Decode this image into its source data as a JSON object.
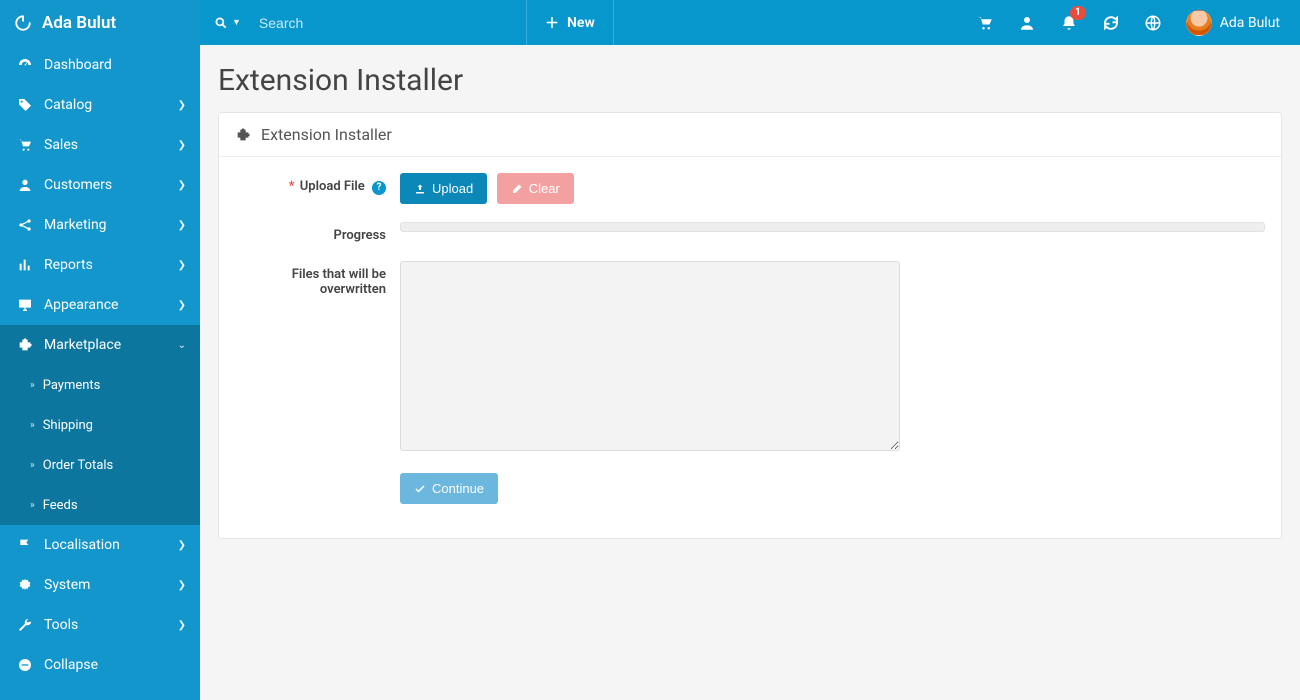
{
  "brand": {
    "name": "Ada Bulut"
  },
  "sidebar": {
    "items": [
      {
        "label": "Dashboard",
        "icon": "gauge",
        "expandable": false
      },
      {
        "label": "Catalog",
        "icon": "tag",
        "expandable": true
      },
      {
        "label": "Sales",
        "icon": "cart",
        "expandable": true
      },
      {
        "label": "Customers",
        "icon": "user",
        "expandable": true
      },
      {
        "label": "Marketing",
        "icon": "share",
        "expandable": true
      },
      {
        "label": "Reports",
        "icon": "bars",
        "expandable": true
      },
      {
        "label": "Appearance",
        "icon": "monitor",
        "expandable": true
      },
      {
        "label": "Marketplace",
        "icon": "puzzle",
        "expandable": true,
        "active": true,
        "children": [
          {
            "label": "Payments"
          },
          {
            "label": "Shipping"
          },
          {
            "label": "Order Totals"
          },
          {
            "label": "Feeds"
          }
        ]
      },
      {
        "label": "Localisation",
        "icon": "flag",
        "expandable": true
      },
      {
        "label": "System",
        "icon": "gear",
        "expandable": true
      },
      {
        "label": "Tools",
        "icon": "wrench",
        "expandable": true
      },
      {
        "label": "Collapse",
        "icon": "minus-circle",
        "expandable": false
      }
    ]
  },
  "topbar": {
    "search_placeholder": "Search",
    "new_label": "New",
    "notifications_count": "1",
    "user_name": "Ada Bulut"
  },
  "page": {
    "title": "Extension Installer",
    "panel_title": "Extension Installer",
    "form": {
      "upload_label": "Upload File",
      "upload_btn": "Upload",
      "clear_btn": "Clear",
      "progress_label": "Progress",
      "overwrite_label": "Files that will be overwritten",
      "continue_btn": "Continue"
    }
  }
}
